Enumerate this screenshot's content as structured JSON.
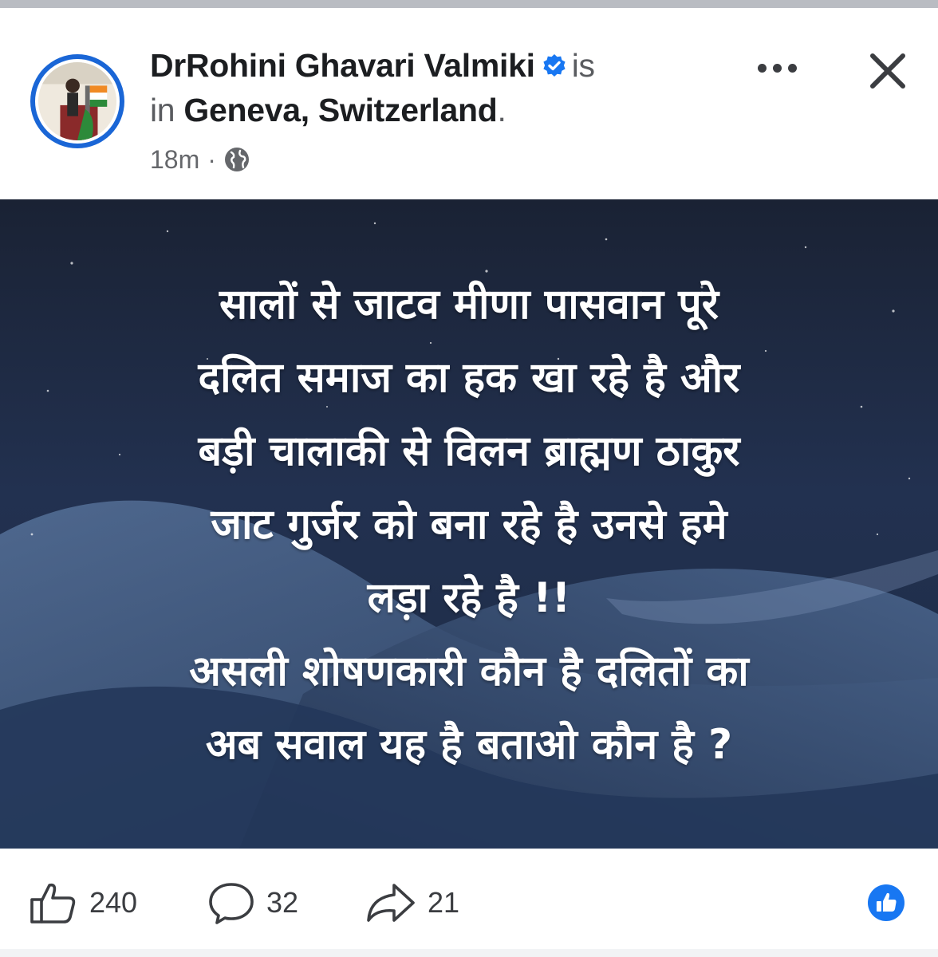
{
  "post": {
    "author": "DrRohini Ghavari Valmiki",
    "verb_is": "is",
    "verb_in": "in",
    "location": "Geneva, Switzerland",
    "location_end": ".",
    "time": "18m",
    "meta_separator": "·",
    "privacy_icon": "globe-icon",
    "verified_icon": "verified-badge-icon",
    "text_lines": [
      "सालों से जाटव मीणा पासवान पूरे",
      "दलित समाज का हक खा रहे है और",
      "बड़ी चालाकी से विलन ब्राह्मण ठाकुर",
      "जाट गुर्जर को बना रहे है उनसे हमे",
      "लड़ा रहे है !!",
      "असली शोषणकारी कौन है दलितों का",
      "अब सवाल यह है बताओ कौन है ?"
    ]
  },
  "header_actions": {
    "more_icon": "more-horizontal-icon",
    "close_icon": "close-icon"
  },
  "reactions": {
    "likes": "240",
    "comments": "32",
    "shares": "21",
    "like_icon": "thumbs-up-icon",
    "comment_icon": "comment-icon",
    "share_icon": "share-icon",
    "badge_icon": "like-badge-icon"
  },
  "colors": {
    "accent": "#1877f2",
    "text_primary": "#1c1e21",
    "text_secondary": "#65676b",
    "post_bg_top": "#1b2438",
    "post_bg_bottom": "#2f4a6e"
  }
}
